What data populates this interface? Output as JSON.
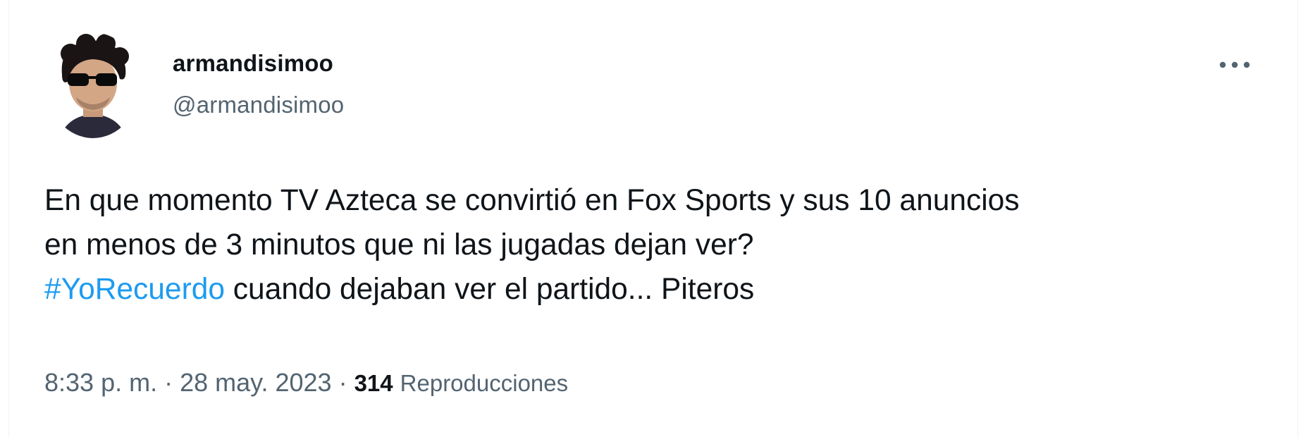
{
  "tweet": {
    "author": {
      "display_name": "armandisimoo",
      "handle": "@armandisimoo"
    },
    "text_lines": [
      "En que momento TV Azteca se convirtió en Fox Sports y sus 10 anuncios",
      "en menos de 3 minutos que ni las jugadas dejan ver?"
    ],
    "hashtag": "#YoRecuerdo",
    "text_after_hashtag": " cuando dejaban ver el partido... Piteros",
    "time": "8:33 p. m.",
    "date": "28 may. 2023",
    "separator": " · ",
    "views_count": "314",
    "views_label": "Reproducciones",
    "icons": {
      "more": "more-horizontal-icon"
    },
    "colors": {
      "text_primary": "#0f1419",
      "text_secondary": "#536471",
      "link": "#1d9bf0"
    }
  }
}
